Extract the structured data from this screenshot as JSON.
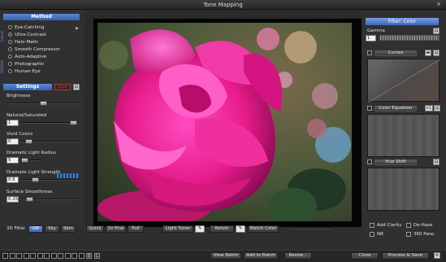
{
  "window": {
    "title": "Tone Mapping",
    "close_glyph": "×"
  },
  "left_panel": {
    "method_header": "Method",
    "side_tabs": {
      "local": "Local",
      "global": "Global"
    },
    "methods": [
      {
        "label": "Eye-Catching",
        "selected": false
      },
      {
        "label": "Ultra-Contrast",
        "selected": true
      },
      {
        "label": "Halo-Matic",
        "selected": false
      },
      {
        "label": "Smooth Compressor",
        "selected": false
      },
      {
        "label": "Auto-Adaptive",
        "selected": false
      },
      {
        "label": "Photographic",
        "selected": false
      },
      {
        "label": "Human Eye",
        "selected": false
      }
    ],
    "settings_header": "Settings",
    "live_label": "Live",
    "settings": [
      {
        "label": "Brightness",
        "value": "",
        "level": 0.5
      },
      {
        "label": "Natural/Saturated",
        "value": "1",
        "level": 0.95
      },
      {
        "label": "Vivid Colors",
        "value": "0",
        "level": 0.08
      },
      {
        "label": "Dramatic Light Radius",
        "value": "5",
        "level": 0.03
      },
      {
        "label": "Dramatic Light Strength",
        "value": "0.6",
        "level": 0.2
      },
      {
        "label": "Surface Smoothness",
        "value": "0.25",
        "level": 0.1
      }
    ]
  },
  "filter_3d": {
    "label": "3D Filter",
    "options": [
      "Off",
      "Sky",
      "Skin"
    ],
    "selected": "Off"
  },
  "toolbar": {
    "quick": "Quick",
    "fine2x": "2x Fine",
    "full": "Full",
    "light_tuner": "Light Tuner",
    "kelvin": "Kelvin",
    "match_color": "Match Color"
  },
  "right_panel": {
    "filter_header": "Filter: Color",
    "gamma_label": "Gamma",
    "gamma_value": "1",
    "curves_label": "Curves",
    "equalizer_label": "Color Equalizer",
    "equalizer_multiplier": "x1",
    "hue_shift_label": "Hue Shift",
    "options": [
      "Add Clarity",
      "De-Haze",
      "NR",
      "360 Pano"
    ]
  },
  "footer": {
    "s_label": "S",
    "l_label": "L",
    "view_batch": "View Batch",
    "add_to_batch": "Add to Batch",
    "resize": "Resize...",
    "close": "Close",
    "process_save": "Process & Save"
  }
}
